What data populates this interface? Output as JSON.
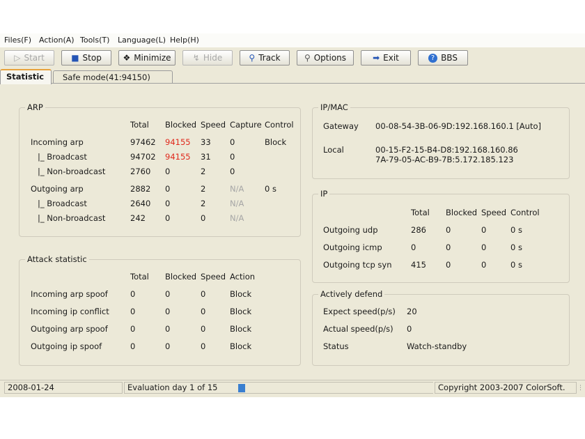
{
  "menu": [
    "Files(F)",
    "Action(A)",
    "Tools(T)",
    "Language(L)",
    "Help(H)"
  ],
  "toolbar": [
    {
      "label": "Start",
      "icon": "play-icon",
      "enabled": false
    },
    {
      "label": "Stop",
      "icon": "stop-icon",
      "enabled": true
    },
    {
      "label": "Minimize",
      "icon": "minimize-icon",
      "enabled": true
    },
    {
      "label": "Hide",
      "icon": "hide-icon",
      "enabled": false
    },
    {
      "label": "Track",
      "icon": "magnifier-icon",
      "enabled": true
    },
    {
      "label": "Options",
      "icon": "options-icon",
      "enabled": true
    },
    {
      "label": "Exit",
      "icon": "exit-icon",
      "enabled": true
    },
    {
      "label": "BBS",
      "icon": "help-icon",
      "enabled": true
    }
  ],
  "tabs": [
    "Statistic",
    "Safe mode(41:94150)"
  ],
  "arp": {
    "title": "ARP",
    "headers": [
      "Total",
      "Blocked",
      "Speed",
      "Capture",
      "Control"
    ],
    "rows": [
      {
        "label": "Incoming arp",
        "total": "97462",
        "blocked": "94155",
        "speed": "33",
        "capture": "0",
        "control": "Block"
      },
      {
        "label": "|_ Broadcast",
        "total": "94702",
        "blocked": "94155",
        "speed": "31",
        "capture": "0",
        "control": ""
      },
      {
        "label": "|_ Non-broadcast",
        "total": "2760",
        "blocked": "0",
        "speed": "2",
        "capture": "0",
        "control": ""
      },
      {
        "label": "Outgoing arp",
        "total": "2882",
        "blocked": "0",
        "speed": "2",
        "capture": "N/A",
        "control": "0 s"
      },
      {
        "label": "|_ Broadcast",
        "total": "2640",
        "blocked": "0",
        "speed": "2",
        "capture": "N/A",
        "control": ""
      },
      {
        "label": "|_ Non-broadcast",
        "total": "242",
        "blocked": "0",
        "speed": "0",
        "capture": "N/A",
        "control": ""
      }
    ]
  },
  "attack": {
    "title": "Attack statistic",
    "headers": [
      "Total",
      "Blocked",
      "Speed",
      "Action"
    ],
    "rows": [
      {
        "label": "Incoming arp spoof",
        "total": "0",
        "blocked": "0",
        "speed": "0",
        "action": "Block"
      },
      {
        "label": "Incoming ip conflict",
        "total": "0",
        "blocked": "0",
        "speed": "0",
        "action": "Block"
      },
      {
        "label": "Outgoing arp spoof",
        "total": "0",
        "blocked": "0",
        "speed": "0",
        "action": "Block"
      },
      {
        "label": "Outgoing ip spoof",
        "total": "0",
        "blocked": "0",
        "speed": "0",
        "action": "Block"
      }
    ]
  },
  "ipmac": {
    "title": "IP/MAC",
    "gateway_label": "Gateway",
    "gateway_value": "00-08-54-3B-06-9D:192.168.160.1 [Auto]",
    "local_label": "Local",
    "local_value_1": "00-15-F2-15-B4-D8:192.168.160.86",
    "local_value_2": "7A-79-05-AC-B9-7B:5.172.185.123"
  },
  "ip": {
    "title": "IP",
    "headers": [
      "Total",
      "Blocked",
      "Speed",
      "Control"
    ],
    "rows": [
      {
        "label": "Outgoing udp",
        "total": "286",
        "blocked": "0",
        "speed": "0",
        "control": "0 s"
      },
      {
        "label": "Outgoing icmp",
        "total": "0",
        "blocked": "0",
        "speed": "0",
        "control": "0 s"
      },
      {
        "label": "Outgoing tcp syn",
        "total": "415",
        "blocked": "0",
        "speed": "0",
        "control": "0 s"
      }
    ]
  },
  "defend": {
    "title": "Actively defend",
    "expect_label": "Expect speed(p/s)",
    "expect_value": "20",
    "actual_label": "Actual speed(p/s)",
    "actual_value": "0",
    "status_label": "Status",
    "status_value": "Watch-standby"
  },
  "statusbar": {
    "date": "2008-01-24",
    "evaluation": "Evaluation day 1 of 15",
    "copyright": "Copyright 2003-2007 ColorSoft."
  },
  "colors": {
    "blocked_highlight": "#e0291d",
    "window_bg": "#ece9d8",
    "tab_accent": "#e8a33d"
  }
}
